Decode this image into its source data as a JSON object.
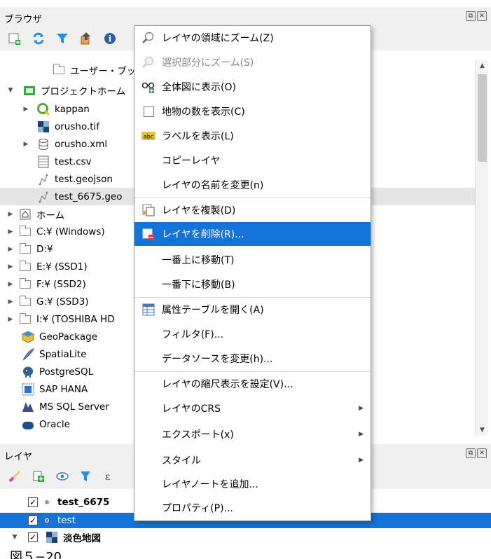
{
  "browser_panel": {
    "title": "ブラウザ",
    "tree": [
      {
        "label": "ユーザー・ブックマ",
        "icon": "folder-icon"
      },
      {
        "label": "プロジェクトホーム",
        "icon": "project-home-icon"
      },
      {
        "label": "kappan",
        "icon": "qgis-project-icon"
      },
      {
        "label": "orusho.tif",
        "icon": "raster-icon"
      },
      {
        "label": "orusho.xml",
        "icon": "database-icon"
      },
      {
        "label": "test.csv",
        "icon": "table-icon"
      },
      {
        "label": "test.geojson",
        "icon": "vector-icon"
      },
      {
        "label": "test_6675.geo",
        "icon": "vector-icon"
      },
      {
        "label": "ホーム",
        "icon": "home-icon"
      },
      {
        "label": "C:¥ (Windows)",
        "icon": "folder-icon"
      },
      {
        "label": "D:¥",
        "icon": "folder-icon"
      },
      {
        "label": "E:¥ (SSD1)",
        "icon": "folder-icon"
      },
      {
        "label": "F:¥ (SSD2)",
        "icon": "folder-icon"
      },
      {
        "label": "G:¥ (SSD3)",
        "icon": "folder-icon"
      },
      {
        "label": "I:¥ (TOSHIBA HD",
        "icon": "folder-icon"
      },
      {
        "label": "GeoPackage",
        "icon": "geopackage-icon"
      },
      {
        "label": "SpatiaLite",
        "icon": "spatialite-icon"
      },
      {
        "label": "PostgreSQL",
        "icon": "postgresql-icon"
      },
      {
        "label": "SAP HANA",
        "icon": "sap-hana-icon"
      },
      {
        "label": "MS SQL Server",
        "icon": "mssql-icon"
      },
      {
        "label": "Oracle",
        "icon": "oracle-icon"
      }
    ]
  },
  "layers_panel": {
    "title": "レイヤ",
    "layers": [
      {
        "label": "test_6675",
        "checked": true,
        "dot_color": "#c08a6a"
      },
      {
        "label": "test",
        "checked": true,
        "dot_color": "#e0543a"
      },
      {
        "label": "淡色地図",
        "checked": true,
        "dot_color": ""
      }
    ]
  },
  "context_menu": {
    "items": [
      {
        "label": "レイヤの領域にズーム(Z)",
        "icon": "zoom-to-layer-icon"
      },
      {
        "label": "選択部分にズーム(S)",
        "icon": "zoom-to-selection-icon",
        "disabled": true
      },
      {
        "label": "全体図に表示(O)",
        "icon": "show-in-overview-icon"
      },
      {
        "label": "地物の数を表示(C)",
        "icon": "checkbox-icon"
      },
      {
        "label": "ラベルを表示(L)",
        "icon": "label-icon"
      },
      {
        "label": "コピーレイヤ",
        "icon": ""
      },
      {
        "label": "レイヤの名前を変更(n)",
        "icon": ""
      },
      {
        "label": "レイヤを複製(D)",
        "icon": "duplicate-layer-icon"
      },
      {
        "label": "レイヤを削除(R)...",
        "icon": "remove-layer-icon",
        "selected": true
      },
      {
        "label": "一番上に移動(T)",
        "icon": ""
      },
      {
        "label": "一番下に移動(B)",
        "icon": ""
      },
      {
        "label": "属性テーブルを開く(A)",
        "icon": "attribute-table-icon"
      },
      {
        "label": "フィルタ(F)...",
        "icon": ""
      },
      {
        "label": "データソースを変更(h)...",
        "icon": ""
      },
      {
        "label": "レイヤの縮尺表示を設定(V)...",
        "icon": ""
      },
      {
        "label": "レイヤのCRS",
        "icon": "",
        "submenu": true
      },
      {
        "label": "エクスポート(x)",
        "icon": "",
        "submenu": true
      },
      {
        "label": "スタイル",
        "icon": "",
        "submenu": true
      },
      {
        "label": "レイヤノートを追加...",
        "icon": ""
      },
      {
        "label": "プロパティ(P)...",
        "icon": ""
      }
    ]
  },
  "caption": "図５−20",
  "colors": {
    "selection": "#1473d6",
    "panel_bg": "#f0f0f0",
    "row_highlight": "#e5e5e5"
  }
}
